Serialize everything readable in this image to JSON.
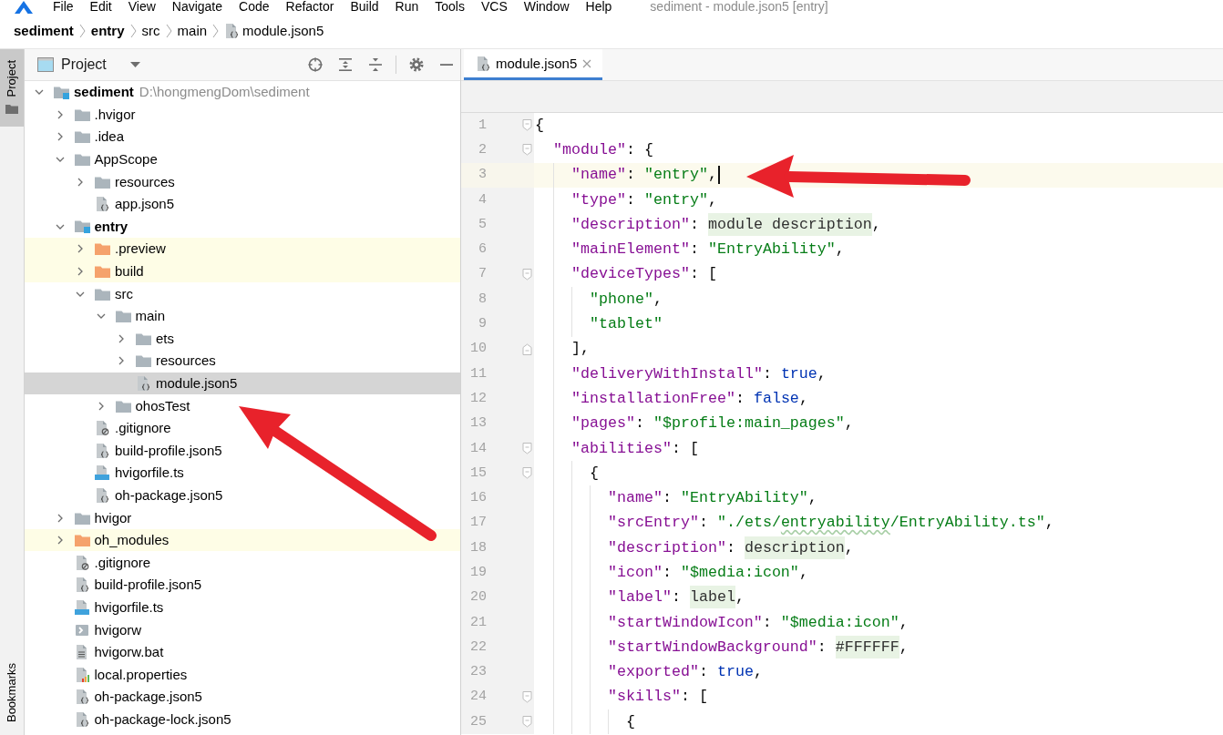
{
  "menu_bar": {
    "items": [
      "File",
      "Edit",
      "View",
      "Navigate",
      "Code",
      "Refactor",
      "Build",
      "Run",
      "Tools",
      "VCS",
      "Window",
      "Help"
    ],
    "window_title": "sediment - module.json5 [entry]"
  },
  "breadcrumbs": [
    {
      "label": "sediment",
      "kind": "module"
    },
    {
      "label": "entry",
      "kind": "module"
    },
    {
      "label": "src",
      "kind": "folder"
    },
    {
      "label": "main",
      "kind": "folder"
    },
    {
      "label": "module.json5",
      "kind": "json"
    }
  ],
  "side_stripe": {
    "tabs": [
      {
        "label": "Project",
        "kind": "project",
        "selected": true
      },
      {
        "label": "Bookmarks",
        "kind": "bookmarks",
        "selected": false
      }
    ]
  },
  "project_panel": {
    "title": "Project",
    "tree": [
      {
        "label": "sediment",
        "kind": "module",
        "path": "D:\\hongmengDom\\sediment",
        "expanded": true,
        "selected": false,
        "arrow": false,
        "children": [
          {
            "label": ".hvigor",
            "kind": "folder",
            "expanded": false,
            "selected": false,
            "arrow": false
          },
          {
            "label": ".idea",
            "kind": "folder",
            "expanded": false,
            "selected": false,
            "arrow": false
          },
          {
            "label": "AppScope",
            "kind": "folder",
            "expanded": true,
            "selected": false,
            "arrow": false,
            "children": [
              {
                "label": "resources",
                "kind": "folder",
                "expanded": false,
                "selected": false,
                "arrow": false
              },
              {
                "label": "app.json5",
                "kind": "json",
                "selected": false,
                "arrow": false
              }
            ]
          },
          {
            "label": "entry",
            "kind": "module",
            "expanded": true,
            "selected": false,
            "arrow": false,
            "children": [
              {
                "label": ".preview",
                "kind": "excluded",
                "expanded": false,
                "selected": false,
                "arrow": false
              },
              {
                "label": "build",
                "kind": "excluded",
                "expanded": false,
                "selected": false,
                "arrow": false
              },
              {
                "label": "src",
                "kind": "folder",
                "expanded": true,
                "selected": false,
                "arrow": false,
                "children": [
                  {
                    "label": "main",
                    "kind": "folder",
                    "expanded": true,
                    "selected": false,
                    "arrow": false,
                    "children": [
                      {
                        "label": "ets",
                        "kind": "folder",
                        "expanded": false,
                        "selected": false,
                        "arrow": false
                      },
                      {
                        "label": "resources",
                        "kind": "folder",
                        "expanded": false,
                        "selected": false,
                        "arrow": false
                      },
                      {
                        "label": "module.json5",
                        "kind": "json",
                        "selected": true,
                        "arrow": false
                      }
                    ]
                  },
                  {
                    "label": "ohosTest",
                    "kind": "folder",
                    "expanded": false,
                    "selected": false,
                    "arrow": true
                  }
                ]
              },
              {
                "label": ".gitignore",
                "kind": "ignore",
                "selected": false,
                "arrow": false
              },
              {
                "label": "build-profile.json5",
                "kind": "json",
                "selected": false,
                "arrow": false
              },
              {
                "label": "hvigorfile.ts",
                "kind": "ts",
                "selected": false,
                "arrow": false
              },
              {
                "label": "oh-package.json5",
                "kind": "json",
                "selected": false,
                "arrow": false
              }
            ]
          },
          {
            "label": "hvigor",
            "kind": "folder",
            "expanded": false,
            "selected": false,
            "arrow": false
          },
          {
            "label": "oh_modules",
            "kind": "excluded",
            "expanded": false,
            "selected": false,
            "arrow": false
          },
          {
            "label": ".gitignore",
            "kind": "ignore",
            "selected": false,
            "arrow": false
          },
          {
            "label": "build-profile.json5",
            "kind": "json",
            "selected": false,
            "arrow": false
          },
          {
            "label": "hvigorfile.ts",
            "kind": "ts",
            "selected": false,
            "arrow": false
          },
          {
            "label": "hvigorw",
            "kind": "script",
            "selected": false,
            "arrow": false
          },
          {
            "label": "hvigorw.bat",
            "kind": "text",
            "selected": false,
            "arrow": false
          },
          {
            "label": "local.properties",
            "kind": "properties",
            "selected": false,
            "arrow": false
          },
          {
            "label": "oh-package.json5",
            "kind": "json",
            "selected": false,
            "arrow": false
          },
          {
            "label": "oh-package-lock.json5",
            "kind": "json",
            "selected": false,
            "arrow": false
          }
        ]
      }
    ]
  },
  "editor": {
    "tabs": [
      {
        "label": "module.json5",
        "kind": "json",
        "selected": true
      }
    ],
    "lines": [
      {
        "number": "1",
        "kind": "fold-start",
        "current": false,
        "arrow": false,
        "tokens": [
          {
            "kind": "punct",
            "text": "{"
          }
        ]
      },
      {
        "number": "2",
        "kind": "fold-start",
        "current": false,
        "arrow": false,
        "tokens": [
          {
            "kind": "key",
            "text": "  \"module\""
          },
          {
            "kind": "punct",
            "text": ": {"
          }
        ]
      },
      {
        "number": "3",
        "kind": "plain",
        "current": true,
        "arrow": true,
        "tokens": [
          {
            "kind": "key",
            "text": "    \"name\""
          },
          {
            "kind": "punct",
            "text": ": "
          },
          {
            "kind": "string",
            "text": "\"entry\""
          },
          {
            "kind": "punct",
            "text": ","
          }
        ]
      },
      {
        "number": "4",
        "kind": "plain",
        "current": false,
        "arrow": false,
        "tokens": [
          {
            "kind": "key",
            "text": "    \"type\""
          },
          {
            "kind": "punct",
            "text": ": "
          },
          {
            "kind": "string",
            "text": "\"entry\""
          },
          {
            "kind": "punct",
            "text": ","
          }
        ]
      },
      {
        "number": "5",
        "kind": "plain",
        "current": false,
        "arrow": false,
        "tokens": [
          {
            "kind": "key",
            "text": "    \"description\""
          },
          {
            "kind": "punct",
            "text": ": "
          },
          {
            "kind": "folded",
            "text": "module description"
          },
          {
            "kind": "punct",
            "text": ","
          }
        ]
      },
      {
        "number": "6",
        "kind": "plain",
        "current": false,
        "arrow": false,
        "tokens": [
          {
            "kind": "key",
            "text": "    \"mainElement\""
          },
          {
            "kind": "punct",
            "text": ": "
          },
          {
            "kind": "string",
            "text": "\"EntryAbility\""
          },
          {
            "kind": "punct",
            "text": ","
          }
        ]
      },
      {
        "number": "7",
        "kind": "fold-start",
        "current": false,
        "arrow": false,
        "tokens": [
          {
            "kind": "key",
            "text": "    \"deviceTypes\""
          },
          {
            "kind": "punct",
            "text": ": ["
          }
        ]
      },
      {
        "number": "8",
        "kind": "plain",
        "current": false,
        "arrow": false,
        "tokens": [
          {
            "kind": "string",
            "text": "      \"phone\""
          },
          {
            "kind": "punct",
            "text": ","
          }
        ]
      },
      {
        "number": "9",
        "kind": "plain",
        "current": false,
        "arrow": false,
        "tokens": [
          {
            "kind": "string",
            "text": "      \"tablet\""
          }
        ]
      },
      {
        "number": "10",
        "kind": "fold-end",
        "current": false,
        "arrow": false,
        "tokens": [
          {
            "kind": "punct",
            "text": "    ],"
          }
        ]
      },
      {
        "number": "11",
        "kind": "plain",
        "current": false,
        "arrow": false,
        "tokens": [
          {
            "kind": "key",
            "text": "    \"deliveryWithInstall\""
          },
          {
            "kind": "punct",
            "text": ": "
          },
          {
            "kind": "literal",
            "text": "true"
          },
          {
            "kind": "punct",
            "text": ","
          }
        ]
      },
      {
        "number": "12",
        "kind": "plain",
        "current": false,
        "arrow": false,
        "tokens": [
          {
            "kind": "key",
            "text": "    \"installationFree\""
          },
          {
            "kind": "punct",
            "text": ": "
          },
          {
            "kind": "literal",
            "text": "false"
          },
          {
            "kind": "punct",
            "text": ","
          }
        ]
      },
      {
        "number": "13",
        "kind": "plain",
        "current": false,
        "arrow": false,
        "tokens": [
          {
            "kind": "key",
            "text": "    \"pages\""
          },
          {
            "kind": "punct",
            "text": ": "
          },
          {
            "kind": "string",
            "text": "\"$profile:main_pages\""
          },
          {
            "kind": "punct",
            "text": ","
          }
        ]
      },
      {
        "number": "14",
        "kind": "fold-start",
        "current": false,
        "arrow": false,
        "tokens": [
          {
            "kind": "key",
            "text": "    \"abilities\""
          },
          {
            "kind": "punct",
            "text": ": ["
          }
        ]
      },
      {
        "number": "15",
        "kind": "fold-start",
        "current": false,
        "arrow": false,
        "tokens": [
          {
            "kind": "punct",
            "text": "      {"
          }
        ]
      },
      {
        "number": "16",
        "kind": "plain",
        "current": false,
        "arrow": false,
        "tokens": [
          {
            "kind": "key",
            "text": "        \"name\""
          },
          {
            "kind": "punct",
            "text": ": "
          },
          {
            "kind": "string",
            "text": "\"EntryAbility\""
          },
          {
            "kind": "punct",
            "text": ","
          }
        ]
      },
      {
        "number": "17",
        "kind": "plain",
        "current": false,
        "arrow": false,
        "tokens": [
          {
            "kind": "key",
            "text": "        \"srcEntry\""
          },
          {
            "kind": "punct",
            "text": ": "
          },
          {
            "kind": "string",
            "text": "\"./ets/"
          },
          {
            "kind": "typo",
            "text": "entryability"
          },
          {
            "kind": "string",
            "text": "/EntryAbility.ts\""
          },
          {
            "kind": "punct",
            "text": ","
          }
        ]
      },
      {
        "number": "18",
        "kind": "plain",
        "current": false,
        "arrow": false,
        "tokens": [
          {
            "kind": "key",
            "text": "        \"description\""
          },
          {
            "kind": "punct",
            "text": ": "
          },
          {
            "kind": "folded",
            "text": "description"
          },
          {
            "kind": "punct",
            "text": ","
          }
        ]
      },
      {
        "number": "19",
        "kind": "plain",
        "current": false,
        "arrow": false,
        "tokens": [
          {
            "kind": "key",
            "text": "        \"icon\""
          },
          {
            "kind": "punct",
            "text": ": "
          },
          {
            "kind": "string",
            "text": "\"$media:icon\""
          },
          {
            "kind": "punct",
            "text": ","
          }
        ]
      },
      {
        "number": "20",
        "kind": "plain",
        "current": false,
        "arrow": false,
        "tokens": [
          {
            "kind": "key",
            "text": "        \"label\""
          },
          {
            "kind": "punct",
            "text": ": "
          },
          {
            "kind": "folded",
            "text": "label"
          },
          {
            "kind": "punct",
            "text": ","
          }
        ]
      },
      {
        "number": "21",
        "kind": "plain",
        "current": false,
        "arrow": false,
        "tokens": [
          {
            "kind": "key",
            "text": "        \"startWindowIcon\""
          },
          {
            "kind": "punct",
            "text": ": "
          },
          {
            "kind": "string",
            "text": "\"$media:icon\""
          },
          {
            "kind": "punct",
            "text": ","
          }
        ]
      },
      {
        "number": "22",
        "kind": "plain",
        "current": false,
        "arrow": false,
        "tokens": [
          {
            "kind": "key",
            "text": "        \"startWindowBackground\""
          },
          {
            "kind": "punct",
            "text": ": "
          },
          {
            "kind": "folded",
            "text": "#FFFFFF"
          },
          {
            "kind": "punct",
            "text": ","
          }
        ]
      },
      {
        "number": "23",
        "kind": "plain",
        "current": false,
        "arrow": false,
        "tokens": [
          {
            "kind": "key",
            "text": "        \"exported\""
          },
          {
            "kind": "punct",
            "text": ": "
          },
          {
            "kind": "literal",
            "text": "true"
          },
          {
            "kind": "punct",
            "text": ","
          }
        ]
      },
      {
        "number": "24",
        "kind": "fold-start",
        "current": false,
        "arrow": false,
        "tokens": [
          {
            "kind": "key",
            "text": "        \"skills\""
          },
          {
            "kind": "punct",
            "text": ": ["
          }
        ]
      },
      {
        "number": "25",
        "kind": "fold-start",
        "current": false,
        "arrow": false,
        "tokens": [
          {
            "kind": "punct",
            "text": "          {"
          }
        ]
      }
    ]
  }
}
